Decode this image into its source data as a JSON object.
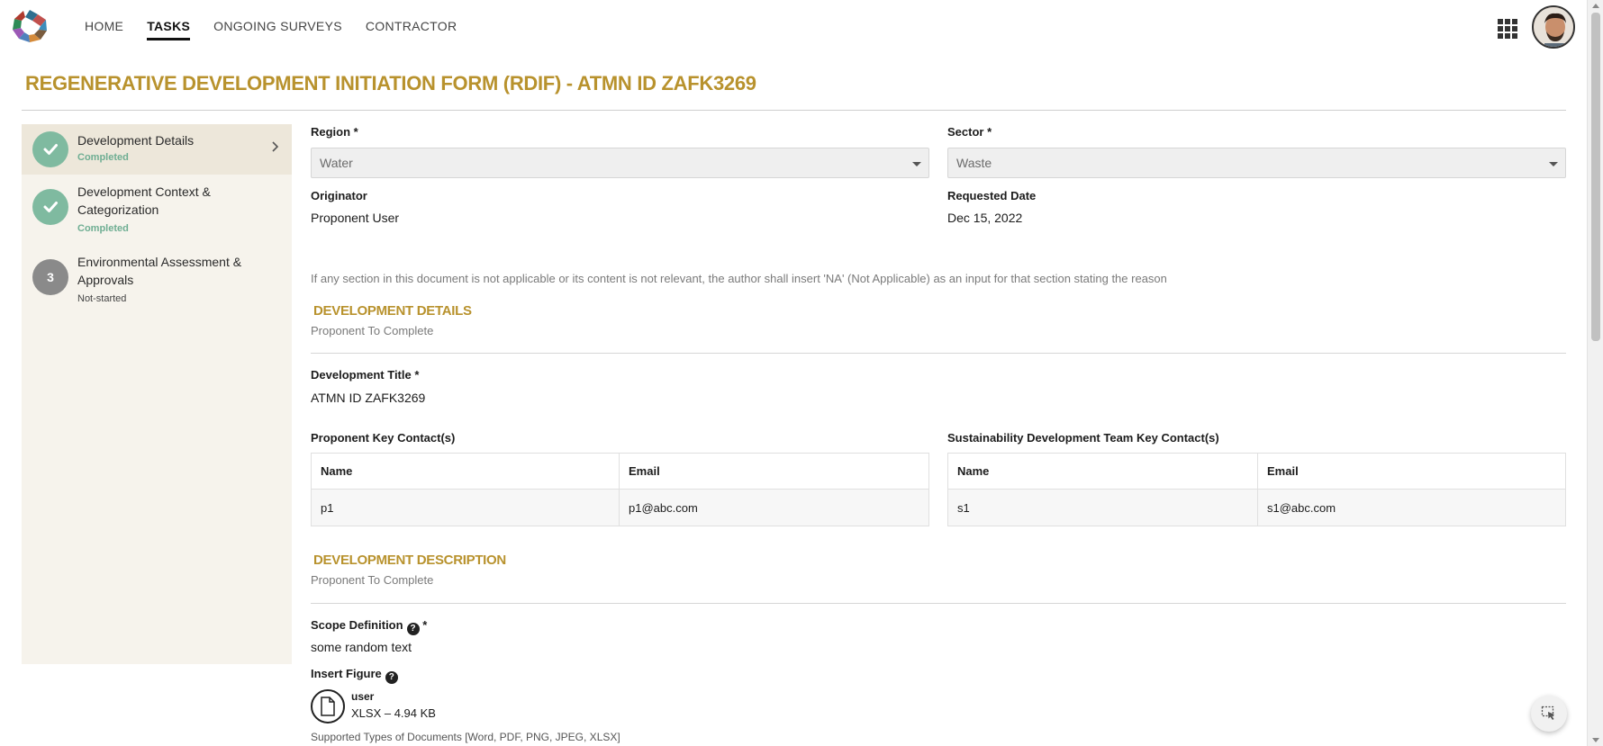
{
  "nav": {
    "items": [
      {
        "label": "HOME"
      },
      {
        "label": "TASKS"
      },
      {
        "label": "ONGOING SURVEYS"
      },
      {
        "label": "CONTRACTOR"
      }
    ],
    "active": "TASKS"
  },
  "page": {
    "title": "REGENERATIVE DEVELOPMENT INITIATION FORM (RDIF) - ATMN ID ZAFK3269"
  },
  "steps": [
    {
      "name": "Development Details",
      "status": "Completed",
      "icon": "check-icon"
    },
    {
      "name": "Development Context & Categorization",
      "status": "Completed",
      "icon": "check-icon"
    },
    {
      "name": "Environmental Assessment & Approvals",
      "status": "Not-started",
      "number": "3"
    }
  ],
  "form": {
    "region_label": "Region *",
    "region_value": "Water",
    "sector_label": "Sector *",
    "sector_value": "Waste",
    "originator_label": "Originator",
    "originator_value": "Proponent User",
    "requested_date_label": "Requested Date",
    "requested_date_value": "Dec 15, 2022",
    "note": "If any section in this document is not applicable or its content is not relevant, the author shall insert 'NA' (Not Applicable) as an input for that section stating the reason"
  },
  "development_details": {
    "title": "DEVELOPMENT DETAILS",
    "subtitle": "Proponent To Complete",
    "dev_title_label": "Development Title *",
    "dev_title_value": "ATMN ID ZAFK3269",
    "proponent_contacts_label": "Proponent Key Contact(s)",
    "team_contacts_label": "Sustainability Development Team Key Contact(s)",
    "columns": [
      "Name",
      "Email"
    ],
    "proponent_rows": [
      {
        "name": "p1",
        "email": "p1@abc.com"
      }
    ],
    "team_rows": [
      {
        "name": "s1",
        "email": "s1@abc.com"
      }
    ]
  },
  "development_description": {
    "title": "DEVELOPMENT DESCRIPTION",
    "subtitle": "Proponent To Complete",
    "scope_label": "Scope Definition",
    "scope_required": "*",
    "scope_value": "some random text",
    "figure_label": "Insert Figure",
    "help_glyph": "?",
    "file_name": "user",
    "file_meta": "XLSX – 4.94 KB",
    "supported_types": "Supported Types of Documents [Word, PDF, PNG, JPEG, XLSX]"
  },
  "colors": {
    "accent": "#b8922d",
    "completed": "#7fbaa0",
    "sidebar_bg": "#f6f3ec",
    "sidebar_active_bg": "#ede7da"
  }
}
